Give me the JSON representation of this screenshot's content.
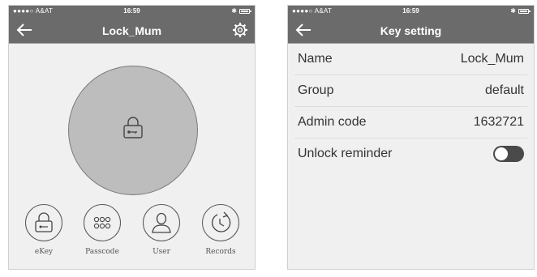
{
  "left_screen": {
    "status_bar": {
      "carrier": "●●●●○ A&AT",
      "time": "16:59"
    },
    "nav": {
      "title": "Lock_Mum"
    },
    "actions": [
      {
        "label": "eKey",
        "icon": "ekey-icon"
      },
      {
        "label": "Passcode",
        "icon": "passcode-icon"
      },
      {
        "label": "User",
        "icon": "user-icon"
      },
      {
        "label": "Records",
        "icon": "records-icon"
      }
    ]
  },
  "right_screen": {
    "status_bar": {
      "carrier": "●●●●○ A&AT",
      "time": "16:59"
    },
    "nav": {
      "title": "Key setting"
    },
    "settings": [
      {
        "label": "Name",
        "value": "Lock_Mum"
      },
      {
        "label": "Group",
        "value": "default"
      },
      {
        "label": "Admin code",
        "value": "1632721"
      },
      {
        "label": "Unlock reminder",
        "value": ""
      }
    ],
    "unlock_reminder_on": false
  },
  "colors": {
    "nav_bg": "#6b6b6b",
    "circle_fill": "#bdbdbd",
    "screen_bg": "#f0f0f0",
    "toggle_off": "#4a4a4a"
  }
}
